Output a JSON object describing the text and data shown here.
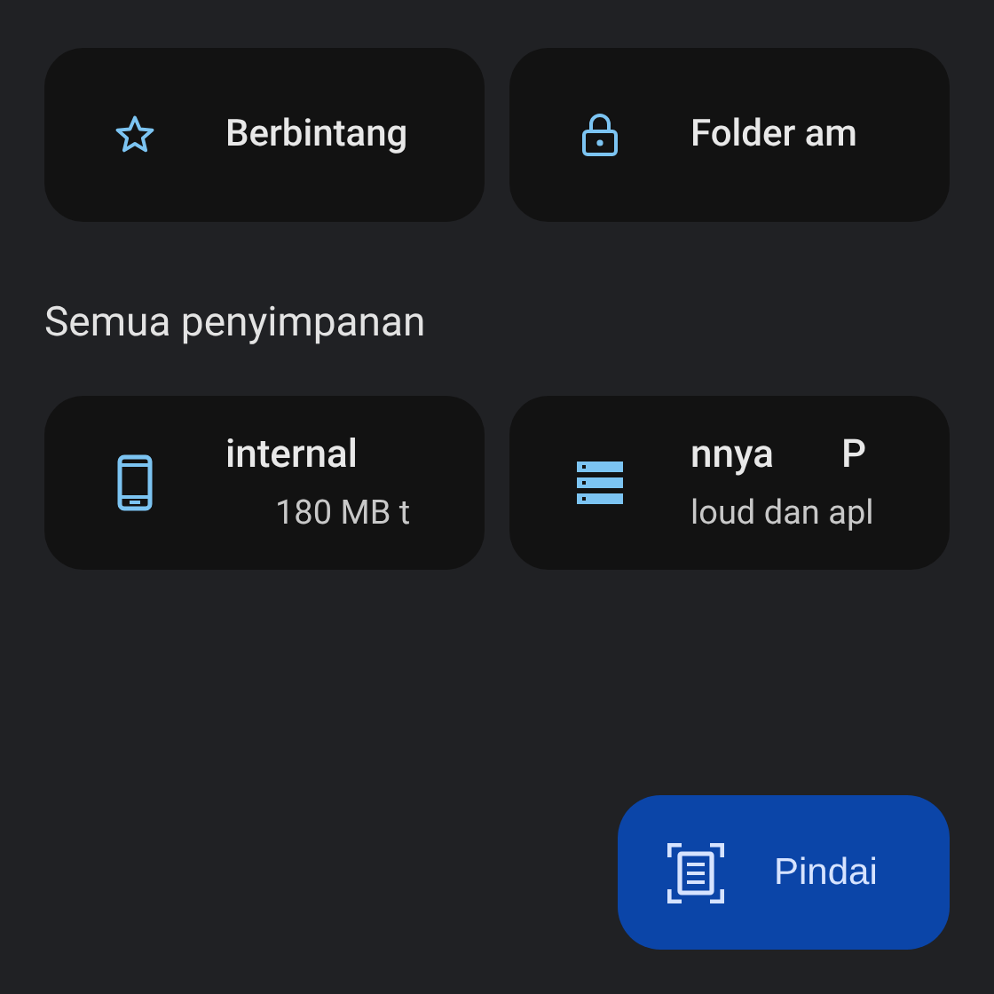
{
  "shortcuts": [
    {
      "kind": "star",
      "label": "Berbintang"
    },
    {
      "kind": "lock",
      "label": "Folder am"
    }
  ],
  "section_title": "Semua penyimpanan",
  "storage": [
    {
      "kind": "phone",
      "title": [
        "internal"
      ],
      "subtitle": "180 MB t"
    },
    {
      "kind": "server",
      "title": [
        "nnya",
        "P"
      ],
      "subtitle": "loud dan apl"
    }
  ],
  "fab": {
    "label": "Pindai"
  }
}
